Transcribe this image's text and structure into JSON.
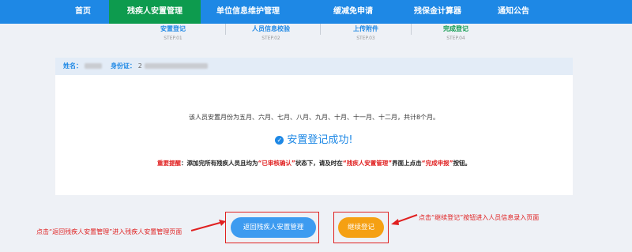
{
  "nav": {
    "items": [
      {
        "label": "首页",
        "active": false
      },
      {
        "label": "残疾人安置管理",
        "active": true
      },
      {
        "label": "单位信息维护管理",
        "active": false
      },
      {
        "label": "缓减免申请",
        "active": false
      },
      {
        "label": "残保金计算器",
        "active": false
      },
      {
        "label": "通知公告",
        "active": false
      }
    ]
  },
  "steps": [
    {
      "title": "安置登记",
      "sub": "STEP.01"
    },
    {
      "title": "人员信息校验",
      "sub": "STEP.02"
    },
    {
      "title": "上传附件",
      "sub": "STEP.03"
    },
    {
      "title": "完成登记",
      "sub": "STEP.04"
    }
  ],
  "info": {
    "name_label": "姓名：",
    "id_label": "身份证：",
    "id_prefix": "2"
  },
  "card": {
    "months_text": "该人员安置月份为五月、六月、七月、八月、九月、十月、十一月、十二月，共计8个月。",
    "success_text": "安置登记成功!",
    "reminder": {
      "label": "重要提醒",
      "p1": "：添加完所有残疾人员且均为",
      "q1": "“已审核确认”",
      "p2": "状态下，请及时在",
      "q2": "“残疾人安置管理”",
      "p3": "界面上点击",
      "q3": "“完成申报”",
      "p4": "按钮。"
    }
  },
  "buttons": {
    "back_label": "返回残疾人安置管理",
    "continue_label": "继续登记"
  },
  "annotations": {
    "left": "点击“返回残疾人安置管理”进入残疾人安置管理页面",
    "right": "点击“继续登记”按钮进入人员信息录入页面"
  },
  "colors": {
    "nav_bg": "#1e88e5",
    "nav_active": "#0d9b4e",
    "accent": "#1e88e5",
    "warning": "#e02020",
    "continue_btn": "#f5a013"
  }
}
